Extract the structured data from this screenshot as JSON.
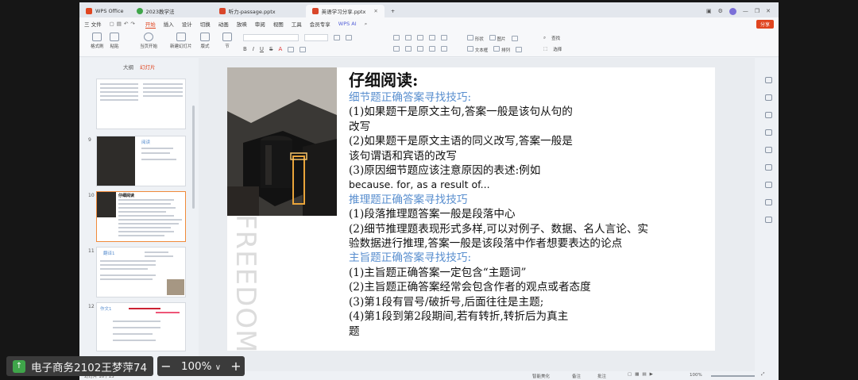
{
  "tabs": [
    {
      "label": "WPS Office"
    },
    {
      "label": "2023教学法"
    },
    {
      "label": "听力-passage.pptx"
    },
    {
      "label": "英语学习分享.pptx"
    }
  ],
  "menu": [
    "三 文件",
    "开始",
    "插入",
    "设计",
    "切换",
    "动画",
    "放映",
    "审阅",
    "视图",
    "工具",
    "会员专享",
    "WPS AI"
  ],
  "share_label": "分享",
  "ribbon": {
    "format_brush": "格式刷",
    "paste": "粘贴",
    "start_show": "当页开始",
    "new_slide": "新建幻灯片",
    "layout": "版式",
    "section": "节",
    "reset": "重置",
    "shape": "形状",
    "image": "图片",
    "textbox": "文本框",
    "arrange": "排列",
    "find": "查找",
    "select": "选择"
  },
  "left_pane": {
    "tab_outline": "大纲",
    "tab_slides": "幻灯片",
    "slide_numbers": [
      "9",
      "10",
      "11",
      "12"
    ],
    "thumb9_title": "阅读",
    "thumb10_title": "仔细阅读",
    "thumb11_title": "翻译1",
    "thumb12_title": "作文1"
  },
  "slide": {
    "image_text": "FREEDOM",
    "title": "仔细阅读:",
    "lines": [
      {
        "text": "细节题正确答案寻找技巧:",
        "style": "blue"
      },
      {
        "text": "(1)如果题干是原文主句,答案一般是该句从句的",
        "style": "body"
      },
      {
        "text": "改写",
        "style": "body"
      },
      {
        "text": "(2)如果题干是原文主语的同义改写,答案一般是",
        "style": "body"
      },
      {
        "text": "该句谓语和宾语的改写",
        "style": "body"
      },
      {
        "text": "(3)原因细节题应该注意原因的表述:例如",
        "style": "body"
      },
      {
        "text": " because. for, as a result of...",
        "style": "sans"
      },
      {
        "text": "推理题正确答案寻找技巧",
        "style": "blue"
      },
      {
        "text": "(1)段落推理题答案一般是段落中心",
        "style": "body"
      },
      {
        "text": "(2)细节推理题表现形式多样,可以对例子、数据、名人言论、实",
        "style": "body"
      },
      {
        "text": "验数据进行推理,答案一般是该段落中作者想要表达的论点",
        "style": "body"
      },
      {
        "text": "主旨题正确答案寻找技巧:",
        "style": "blue"
      },
      {
        "text": "(1)主旨题正确答案一定包含“主题词”",
        "style": "body"
      },
      {
        "text": "(2)主旨题正确答案经常会包含作者的观点或者态度",
        "style": "body"
      },
      {
        "text": "(3)第1段有冒号/破折号,后面往往是主题;",
        "style": "body"
      },
      {
        "text": "(4)第1段到第2段期间,若有转折,转折后为真主",
        "style": "body"
      },
      {
        "text": "题",
        "style": "body"
      }
    ]
  },
  "status": {
    "left": "幻灯片 10 / 13",
    "zoom": "100%",
    "notes": "备注",
    "comment": "批注",
    "smart_beautify": "智能美化"
  },
  "overlay": {
    "participant": "电子商务2102王梦萍74",
    "zoom_minus": "−",
    "zoom_value": "100%",
    "zoom_caret": "∨",
    "zoom_plus": "+"
  },
  "colors": {
    "accent": "#e0451f",
    "heading_blue": "#5a8fcf"
  }
}
